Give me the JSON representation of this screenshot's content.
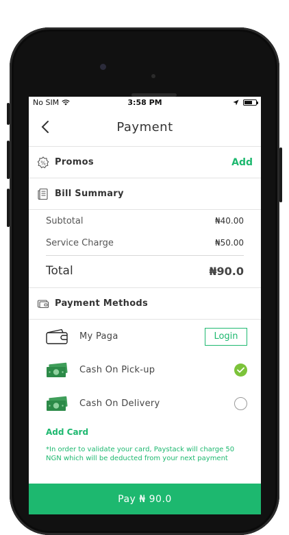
{
  "status_bar": {
    "carrier": "No SIM",
    "time": "3:58 PM"
  },
  "nav": {
    "title": "Payment"
  },
  "promos": {
    "label": "Promos",
    "action": "Add"
  },
  "bill_summary": {
    "label": "Bill Summary",
    "lines": [
      {
        "label": "Subtotal",
        "amount": "₦40.00"
      },
      {
        "label": "Service Charge",
        "amount": "₦50.00"
      }
    ],
    "total_label": "Total",
    "total_amount": "₦90.0"
  },
  "payment_methods": {
    "label": "Payment Methods",
    "items": [
      {
        "label": "My Paga",
        "action": "Login"
      },
      {
        "label": "Cash On Pick-up",
        "selected": true
      },
      {
        "label": "Cash On Delivery",
        "selected": false
      }
    ]
  },
  "add_card": "Add Card",
  "note": "*In order to validate your card, Paystack will charge 50 NGN which will be deducted from your next payment",
  "pay_button": "Pay ₦ 90.0",
  "colors": {
    "accent": "#1db86f",
    "check": "#7cc33a"
  }
}
